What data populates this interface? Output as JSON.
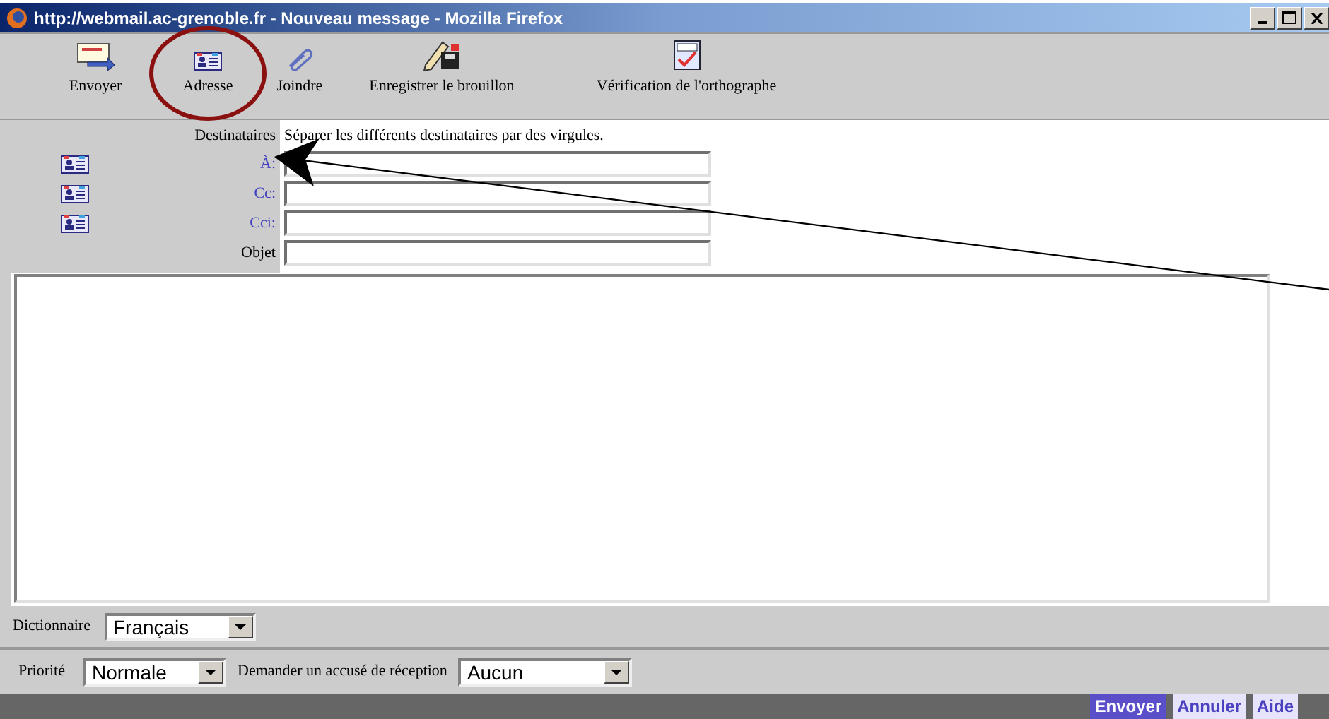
{
  "window": {
    "title": "http://webmail.ac-grenoble.fr - Nouveau message - Mozilla Firefox"
  },
  "toolbar": [
    {
      "kind": "send",
      "label": "Envoyer"
    },
    {
      "kind": "address",
      "label": "Adresse"
    },
    {
      "kind": "attach",
      "label": "Joindre"
    },
    {
      "kind": "draft",
      "label": "Enregistrer le brouillon"
    },
    {
      "kind": "spell",
      "label": "Vérification de l'orthographe"
    }
  ],
  "recipients": {
    "label": "Destinataires",
    "hint": "Séparer les différents destinataires par des virgules."
  },
  "fields": [
    {
      "kind": "address",
      "label": "À:"
    },
    {
      "kind": "address",
      "label": "Cc:"
    },
    {
      "kind": "address",
      "label": "Cci:"
    },
    {
      "kind": "plain",
      "label": "Objet"
    }
  ],
  "dictionary": {
    "label": "Dictionnaire",
    "value": "Français"
  },
  "priority": {
    "label": "Priorité",
    "value": "Normale"
  },
  "receipt": {
    "label": "Demander un accusé de réception",
    "value": "Aucun"
  },
  "buttons": [
    {
      "kind": "primary",
      "label": "Envoyer"
    },
    {
      "kind": "secondary",
      "label": "Annuler"
    },
    {
      "kind": "secondary",
      "label": "Aide"
    }
  ]
}
